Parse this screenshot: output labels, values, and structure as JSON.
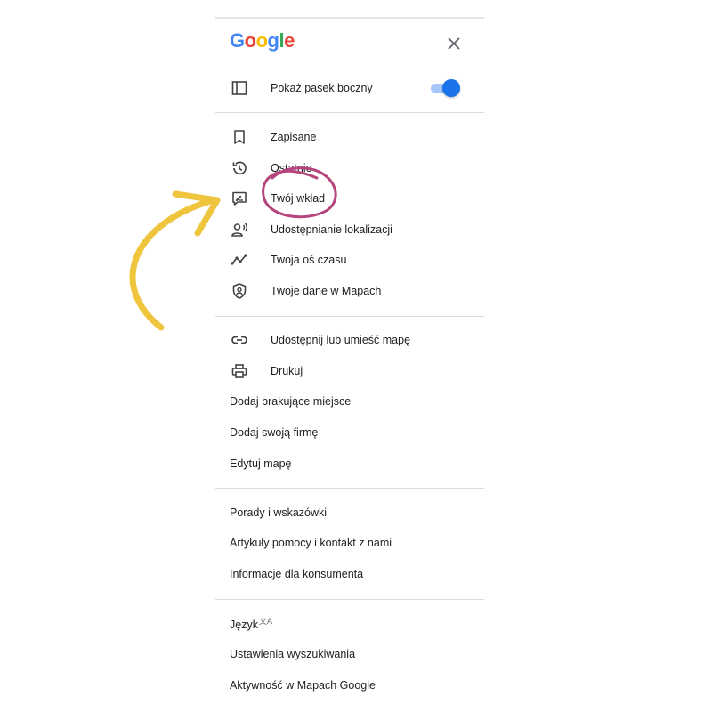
{
  "logo": {
    "letters": [
      {
        "char": "G",
        "color": "#4285F4"
      },
      {
        "char": "o",
        "color": "#EA4335"
      },
      {
        "char": "o",
        "color": "#FBBC05"
      },
      {
        "char": "g",
        "color": "#4285F4"
      },
      {
        "char": "l",
        "color": "#34A853"
      },
      {
        "char": "e",
        "color": "#EA4335"
      }
    ]
  },
  "header": {
    "close_icon": "close-icon"
  },
  "sidebar_toggle": {
    "label": "Pokaż pasek boczny",
    "icon": "sidebar-panel-icon",
    "on": true,
    "color": "#1a73e8"
  },
  "personal_section": {
    "items": [
      {
        "label": "Zapisane",
        "icon": "bookmark-icon"
      },
      {
        "label": "Ostatnie",
        "icon": "history-icon"
      },
      {
        "label": "Twój wkład",
        "icon": "contribute-icon"
      },
      {
        "label": "Udostępnianie lokalizacji",
        "icon": "location-sharing-icon"
      },
      {
        "label": "Twoja oś czasu",
        "icon": "timeline-icon"
      },
      {
        "label": "Twoje dane w Mapach",
        "icon": "shield-icon"
      }
    ]
  },
  "share_section": {
    "items": [
      {
        "label": "Udostępnij lub umieść mapę",
        "icon": "link-icon"
      },
      {
        "label": "Drukuj",
        "icon": "printer-icon"
      },
      {
        "label": "Dodaj brakujące miejsce"
      },
      {
        "label": "Dodaj swoją firmę"
      },
      {
        "label": "Edytuj mapę"
      }
    ]
  },
  "help_section": {
    "items": [
      {
        "label": "Porady i wskazówki"
      },
      {
        "label": "Artykuły pomocy i kontakt z nami"
      },
      {
        "label": "Informacje dla konsumenta"
      }
    ]
  },
  "settings_section": {
    "items": [
      {
        "label": "Język",
        "icon": "translate-icon"
      },
      {
        "label": "Ustawienia wyszukiwania"
      },
      {
        "label": "Aktywność w Mapach Google"
      }
    ]
  },
  "annotations": {
    "arrow_color": "#f0c53e",
    "circle_color": "#b5457c"
  }
}
